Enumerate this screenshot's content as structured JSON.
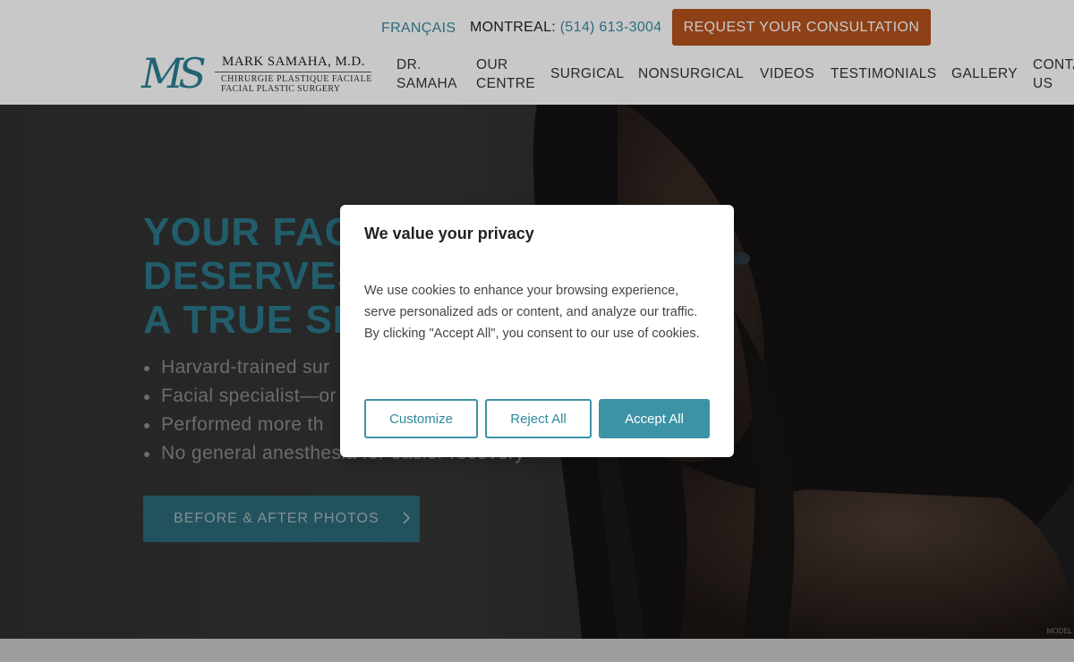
{
  "header": {
    "language_link": "FRANÇAIS",
    "phone_label": "MONTREAL:",
    "phone_number": "(514) 613-3004",
    "cta_button": "REQUEST YOUR CONSULTATION",
    "logo": {
      "monogram": "MS",
      "name": "MARK SAMAHA, M.D.",
      "subtitle_fr": "CHIRURGIE PLASTIQUE FACIALE",
      "subtitle_en": "FACIAL PLASTIC SURGERY"
    },
    "nav": {
      "dr_samaha": [
        "DR.",
        "SAMAHA"
      ],
      "our_centre": [
        "OUR",
        "CENTRE"
      ],
      "surgical": "SURGICAL",
      "nonsurgical": "NONSURGICAL",
      "videos": "VIDEOS",
      "testimonials": "TESTIMONIALS",
      "gallery": "GALLERY",
      "contact_us": [
        "CONTA",
        "US"
      ]
    }
  },
  "hero": {
    "title_line1": "YOUR FAC",
    "title_line2": "DESERVES",
    "title_line3": "A TRUE SP",
    "bullets": [
      "Harvard-trained sur",
      "Facial specialist—or",
      "Performed more th",
      "No general anesthesia for easier recovery"
    ],
    "button": "BEFORE & AFTER PHOTOS",
    "model_tag": "MODEL"
  },
  "cookie_modal": {
    "title": "We value your privacy",
    "body": "We use cookies to enhance your browsing experience, serve personalized ads or content, and analyze our traffic. By clicking \"Accept All\", you consent to our use of cookies.",
    "customize": "Customize",
    "reject": "Reject All",
    "accept": "Accept All"
  },
  "colors": {
    "accent_teal": "#3c93a6",
    "cta_orange": "#b4521c",
    "hero_title": "#2c7688"
  }
}
